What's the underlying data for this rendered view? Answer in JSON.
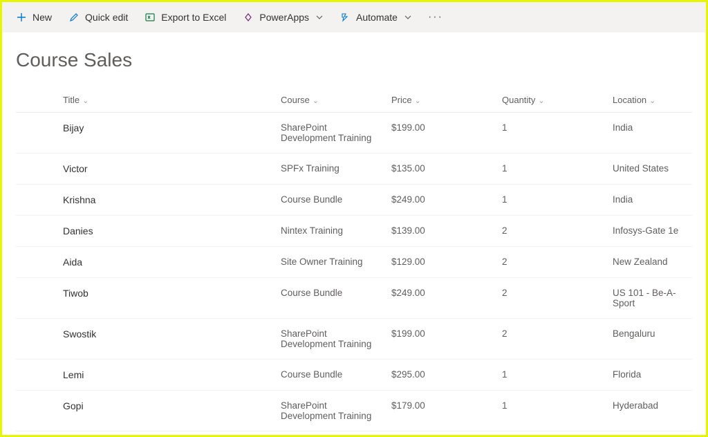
{
  "toolbar": {
    "new_label": "New",
    "quick_edit_label": "Quick edit",
    "export_label": "Export to Excel",
    "powerapps_label": "PowerApps",
    "automate_label": "Automate"
  },
  "page": {
    "title": "Course Sales"
  },
  "columns": {
    "title": "Title",
    "course": "Course",
    "price": "Price",
    "quantity": "Quantity",
    "location": "Location"
  },
  "rows": [
    {
      "title": "Bijay",
      "course": "SharePoint Development Training",
      "price": "$199.00",
      "quantity": "1",
      "location": "India"
    },
    {
      "title": "Victor",
      "course": "SPFx Training",
      "price": "$135.00",
      "quantity": "1",
      "location": "United States"
    },
    {
      "title": "Krishna",
      "course": "Course Bundle",
      "price": "$249.00",
      "quantity": "1",
      "location": "India"
    },
    {
      "title": "Danies",
      "course": "Nintex Training",
      "price": "$139.00",
      "quantity": "2",
      "location": "Infosys-Gate 1e"
    },
    {
      "title": "Aida",
      "course": "Site Owner Training",
      "price": "$129.00",
      "quantity": "2",
      "location": "New Zealand"
    },
    {
      "title": "Tiwob",
      "course": "Course Bundle",
      "price": "$249.00",
      "quantity": "2",
      "location": "US 101 - Be-A-Sport"
    },
    {
      "title": "Swostik",
      "course": "SharePoint Development Training",
      "price": "$199.00",
      "quantity": "2",
      "location": "Bengaluru"
    },
    {
      "title": "Lemi",
      "course": "Course Bundle",
      "price": "$295.00",
      "quantity": "1",
      "location": "Florida"
    },
    {
      "title": "Gopi",
      "course": "SharePoint Development Training",
      "price": "$179.00",
      "quantity": "1",
      "location": "Hyderabad"
    }
  ]
}
